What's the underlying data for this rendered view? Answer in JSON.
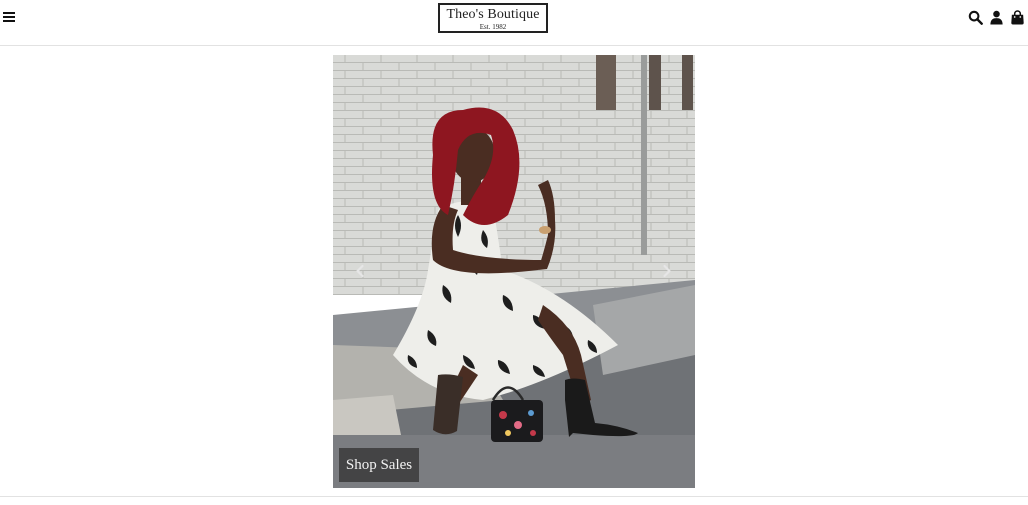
{
  "header": {
    "menu_icon": "hamburger-menu-icon",
    "logo_name": "Theo's Boutique",
    "logo_est": "Est. 1982",
    "icons": [
      "search-icon",
      "user-icon",
      "shopping-bag-icon"
    ]
  },
  "carousel": {
    "prev_icon": "chevron-left-icon",
    "next_icon": "chevron-right-icon",
    "cta_label": "Shop Sales"
  },
  "colors": {
    "text": "#111111",
    "divider": "#e2e2e2",
    "cta_background": "#3c3c3c",
    "cta_text": "#f2f2f2"
  }
}
